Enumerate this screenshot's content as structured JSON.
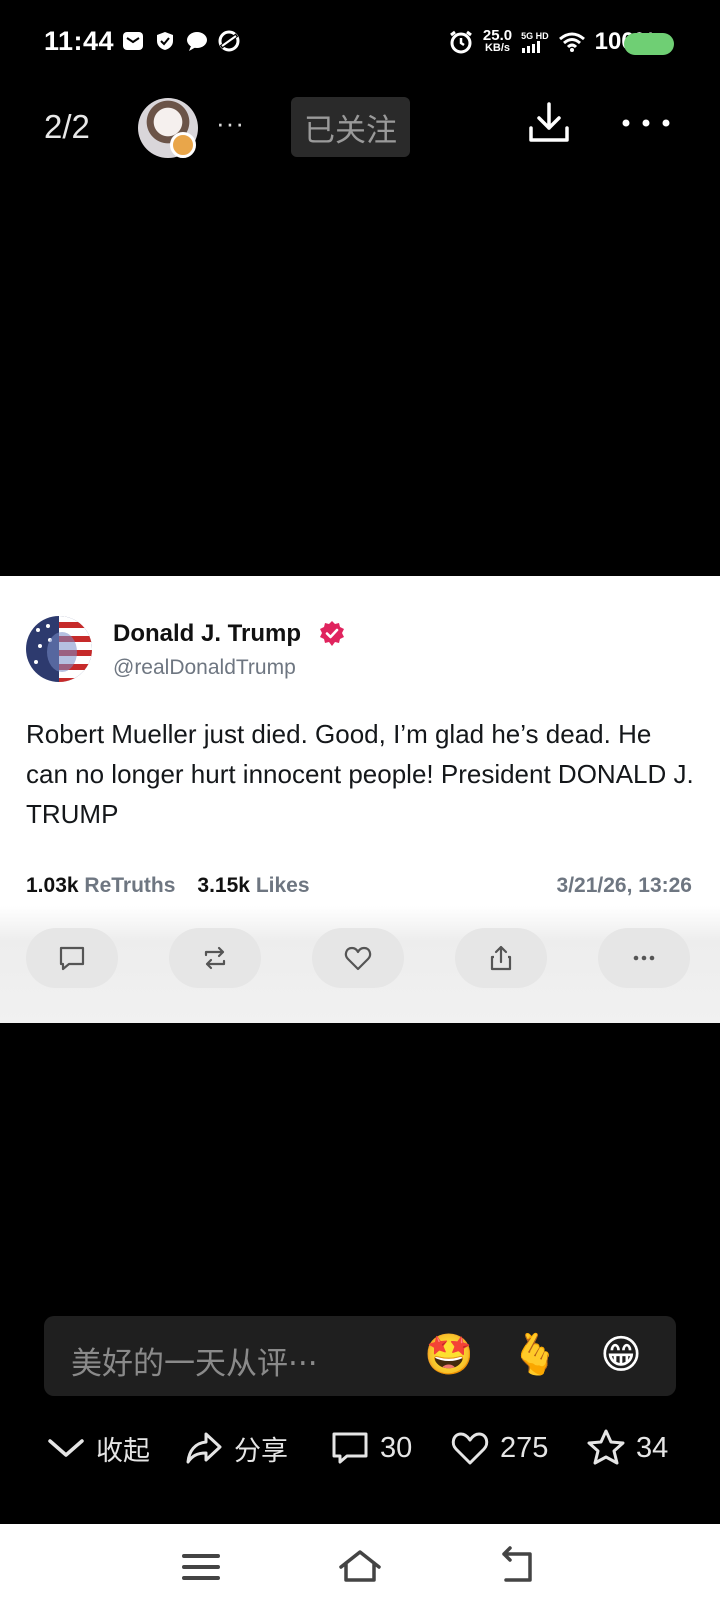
{
  "status_bar": {
    "time": "11:44",
    "net_speed_value": "25.0",
    "net_speed_unit": "KB/s",
    "network_type": "5G HD",
    "battery_percent": "100%",
    "battery_color": "#6fcf74"
  },
  "top_nav": {
    "page_indicator": "2/2",
    "more_dots": "···",
    "follow_label": "已关注"
  },
  "post": {
    "author_name": "Donald J. Trump",
    "author_handle": "@realDonaldTrump",
    "text": "Robert Mueller just died. Good, I’m glad he’s dead. He can no longer hurt innocent people! President DONALD J. TRUMP",
    "retruths_count": "1.03k",
    "retruths_label": "ReTruths",
    "likes_count": "3.15k",
    "likes_label": "Likes",
    "date": "3/21/26, 13:26",
    "verified_color": "#e0245e"
  },
  "comment_bar": {
    "placeholder": "美好的一天从评···",
    "emojis": [
      "🤩",
      "🫰",
      "😁"
    ]
  },
  "bottom_actions": {
    "collapse_label": "收起",
    "share_label": "分享",
    "comments_count": "30",
    "likes_count": "275",
    "favorites_count": "34"
  }
}
